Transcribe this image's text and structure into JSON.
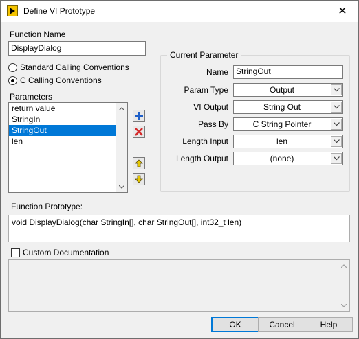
{
  "window": {
    "title": "Define VI Prototype",
    "close_glyph": "✕"
  },
  "function_name": {
    "label": "Function Name",
    "value": "DisplayDialog"
  },
  "calling": {
    "standard": "Standard Calling Conventions",
    "c": "C Calling Conventions",
    "selected": "c"
  },
  "parameters": {
    "label": "Parameters",
    "items": [
      "return value",
      "StringIn",
      "StringOut",
      "len"
    ],
    "selected_index": 2
  },
  "current_parameter": {
    "title": "Current Parameter",
    "name_label": "Name",
    "name_value": "StringOut",
    "fields": [
      {
        "label": "Param Type",
        "value": "Output"
      },
      {
        "label": "VI Output",
        "value": "String Out"
      },
      {
        "label": "Pass By",
        "value": "C String Pointer"
      },
      {
        "label": "Length Input",
        "value": "len"
      },
      {
        "label": "Length Output",
        "value": "(none)"
      }
    ]
  },
  "prototype": {
    "label": "Function Prototype:",
    "text": "void DisplayDialog(char StringIn[], char StringOut[], int32_t len)"
  },
  "custom_doc": {
    "label": "Custom Documentation",
    "checked": false
  },
  "buttons": {
    "ok": "OK",
    "cancel": "Cancel",
    "help": "Help"
  },
  "colors": {
    "selection": "#0078d7",
    "add": "#1e5fc8",
    "remove": "#d42a2a",
    "arrow": "#e6c800"
  },
  "icons": [
    "labview-icon",
    "close-icon",
    "add-icon",
    "remove-icon",
    "move-up-icon",
    "move-down-icon",
    "chevron-down-icon"
  ]
}
